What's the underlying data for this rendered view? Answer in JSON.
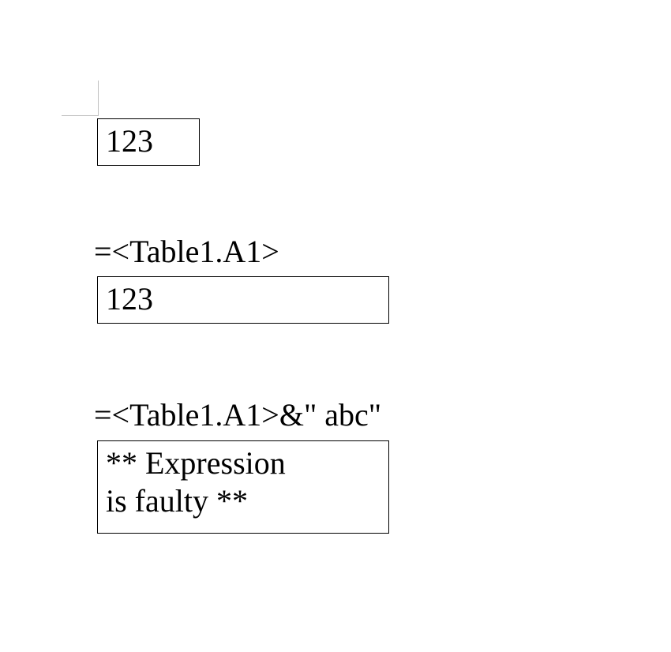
{
  "block1": {
    "cell_value": "123"
  },
  "block2": {
    "formula": "=<Table1.A1>",
    "cell_value": "123"
  },
  "block3": {
    "formula": "=<Table1.A1>&\" abc\"",
    "cell_line1": "** Expression",
    "cell_line2": "is faulty **"
  }
}
